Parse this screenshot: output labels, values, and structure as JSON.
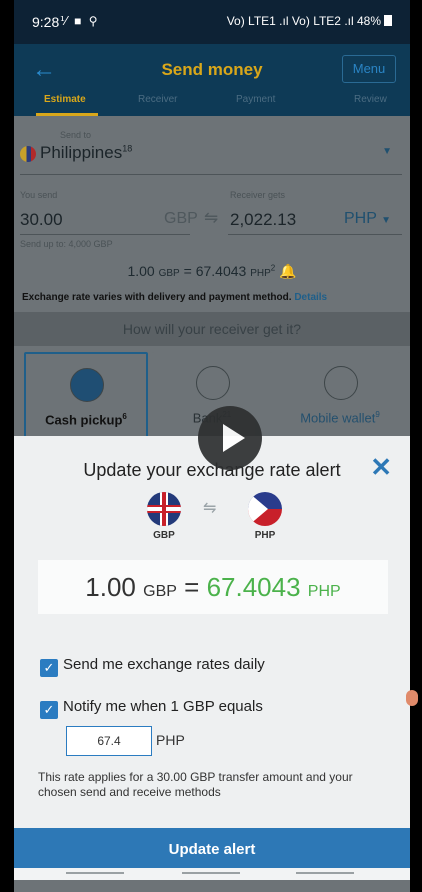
{
  "status": {
    "time": "9:28",
    "left_icons": "⅟ ■ ⚲",
    "right": "Vo) LTE1 .ıl Vo) LTE2 .ıl 48%"
  },
  "header": {
    "title": "Send money",
    "menu_label": "Menu",
    "back_icon": "arrow-left-icon",
    "steps": [
      {
        "label": "Estimate",
        "active": true
      },
      {
        "label": "Receiver",
        "active": false
      },
      {
        "label": "Payment",
        "active": false
      },
      {
        "label": "Review",
        "active": false
      }
    ]
  },
  "form": {
    "send_to_label": "Send to",
    "country": "Philippines",
    "country_sup": "18",
    "you_send_label": "You send",
    "you_send_amount": "30.00",
    "send_currency": "GBP",
    "receiver_gets_label": "Receiver gets",
    "receiver_amount": "2,022.13",
    "receive_currency": "PHP",
    "send_up_to": "Send up to: 4,000  GBP",
    "rate_left": "1.00",
    "rate_left_unit": "GBP",
    "rate_equals": "= 67.4043",
    "rate_right_unit": "PHP",
    "rate_sup": "2",
    "rate_note": "Exchange rate varies with delivery and payment method.",
    "details_link": "Details",
    "how_prompt": "How will your receiver get it?",
    "methods": [
      {
        "label": "Cash pickup",
        "sup": "6",
        "selected": true
      },
      {
        "label": "Bank",
        "sup": "21",
        "selected": false
      },
      {
        "label": "Mobile wallet",
        "sup": "9",
        "selected": false
      }
    ]
  },
  "modal": {
    "title": "Update your exchange rate alert",
    "from_code": "GBP",
    "to_code": "PHP",
    "rate_from": "1.00",
    "rate_from_unit": "GBP",
    "rate_eq": "=",
    "rate_to": "67.4043",
    "rate_to_unit": "PHP",
    "opt_daily": "Send me exchange rates daily",
    "opt_notify": "Notify me when 1 GBP equals",
    "alert_value": "67.4",
    "alert_unit": "PHP",
    "fine_print": "This rate applies for a 30.00 GBP transfer amount and your chosen send and receive methods",
    "update_button": "Update alert"
  },
  "colors": {
    "header": "#0e3a56",
    "accent": "#d9a71a",
    "primary": "#2d78b6",
    "green": "#4bb24b"
  }
}
